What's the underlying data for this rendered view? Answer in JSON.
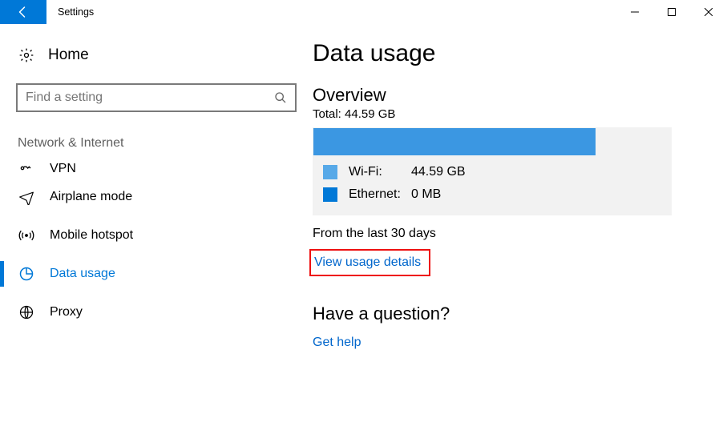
{
  "window": {
    "title": "Settings"
  },
  "sidebar": {
    "home_label": "Home",
    "search_placeholder": "Find a setting",
    "category": "Network & Internet",
    "items": [
      {
        "label": "VPN"
      },
      {
        "label": "Airplane mode"
      },
      {
        "label": "Mobile hotspot"
      },
      {
        "label": "Data usage"
      },
      {
        "label": "Proxy"
      }
    ]
  },
  "main": {
    "title": "Data usage",
    "overview_heading": "Overview",
    "total_label": "Total: 44.59 GB",
    "period_label": "From the last 30 days",
    "view_details_label": "View usage details",
    "question_heading": "Have a question?",
    "get_help_label": "Get help"
  },
  "chart_data": {
    "type": "bar",
    "bar_fill_percent": 79,
    "series": [
      {
        "name": "Wi-Fi:",
        "value_text": "44.59 GB",
        "color": "#57a9e8"
      },
      {
        "name": "Ethernet:",
        "value_text": "0 MB",
        "color": "#0078d7"
      }
    ]
  }
}
